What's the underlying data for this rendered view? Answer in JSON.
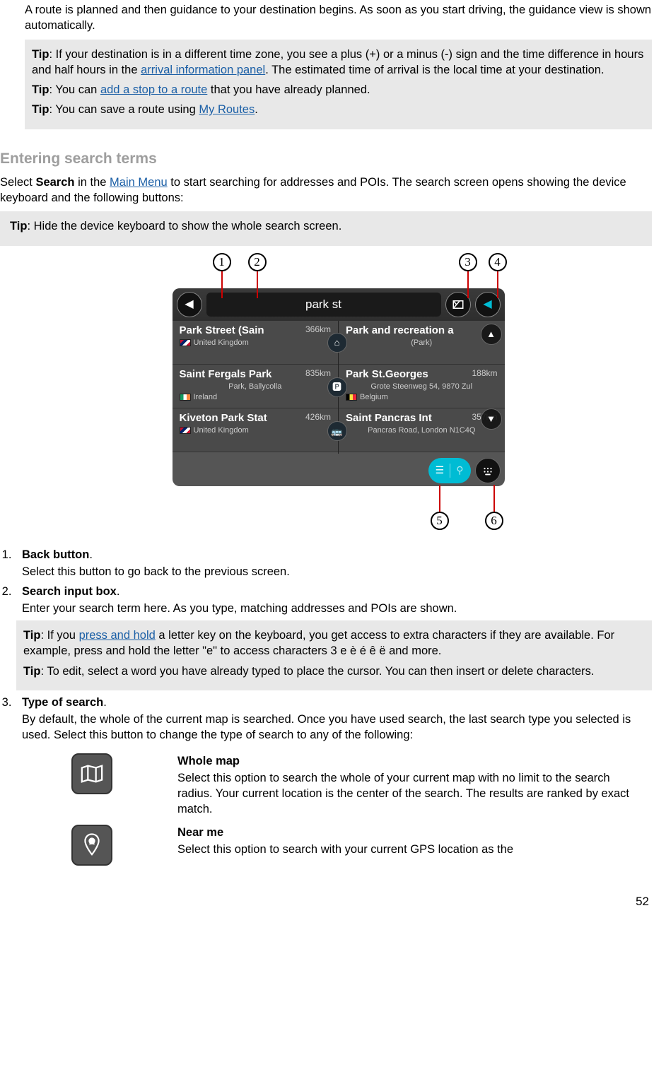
{
  "intro": {
    "p1": "A route is planned and then guidance to your destination begins. As soon as you start driving, the guidance view is shown automatically."
  },
  "tipbox1": {
    "t1a": "Tip",
    "t1b": ": If your destination is in a different time zone, you see a plus (+) or a minus (-) sign and the time difference in hours and half hours in the ",
    "t1link": "arrival information panel",
    "t1c": ". The estimated time of arrival is the local time at your destination.",
    "t2a": "Tip",
    "t2b": ": You can ",
    "t2link": "add a stop to a route",
    "t2c": " that you have already planned.",
    "t3a": "Tip",
    "t3b": ": You can save a route using ",
    "t3link": "My Routes",
    "t3c": "."
  },
  "heading1": "Entering search terms",
  "para2a": "Select ",
  "para2b": "Search",
  "para2c": " in the ",
  "para2link": "Main Menu",
  "para2d": " to start searching for addresses and POIs. The search screen opens showing the device keyboard and the following buttons:",
  "tipbox2": {
    "a": "Tip",
    "b": ": Hide the device keyboard to show the whole search screen."
  },
  "callouts": {
    "c1": "1",
    "c2": "2",
    "c3": "3",
    "c4": "4",
    "c5": "5",
    "c6": "6"
  },
  "device": {
    "searchText": "park st",
    "left": [
      {
        "title": "Park Street (Sain",
        "dist": "366km",
        "sub": "",
        "country": "United Kingdom",
        "flag": "uk"
      },
      {
        "title": "Saint Fergals Park",
        "dist": "835km",
        "sub": "Park, Ballycolla",
        "country": "Ireland",
        "flag": "ie"
      },
      {
        "title": "Kiveton Park Stat",
        "dist": "426km",
        "sub": "",
        "country": "United Kingdom",
        "flag": "uk"
      }
    ],
    "right": [
      {
        "title": "Park and recreation a",
        "dist": "",
        "sub": "(Park)",
        "country": "",
        "flag": ""
      },
      {
        "title": "Park St.Georges",
        "dist": "188km",
        "sub": "Grote Steenweg 54, 9870 Zul",
        "country": "Belgium",
        "flag": "be"
      },
      {
        "title": "Saint Pancras Int",
        "dist": "357km",
        "sub": "Pancras Road, London N1C4Q",
        "country": "",
        "flag": ""
      }
    ]
  },
  "list": {
    "i1t": "Back button",
    "i1d": "Select this button to go back to the previous screen.",
    "i2t": "Search input box",
    "i2d": "Enter your search term here. As you type, matching addresses and POIs are shown.",
    "tipbox3": {
      "a1": "Tip",
      "a2": ": If you ",
      "alink": "press and hold",
      "a3": " a letter key on the keyboard, you get access to extra characters if they are available. For example, press and hold the letter \"e\" to access characters 3 e è é ê ë and more.",
      "b1": "Tip",
      "b2": ": To edit, select a word you have already typed to place the cursor. You can then insert or delete characters."
    },
    "i3t": "Type of search",
    "i3d": "By default, the whole of the current map is searched. Once you have used search, the last search type you selected is used. Select this button to change the type of search to any of the following:"
  },
  "options": {
    "o1t": "Whole map",
    "o1d": "Select this option to search the whole of your current map with no limit to the search radius. Your current location is the center of the search. The results are ranked by exact match.",
    "o2t": "Near me",
    "o2d": "Select this option to search with your current GPS location as the"
  },
  "pagenum": "52"
}
